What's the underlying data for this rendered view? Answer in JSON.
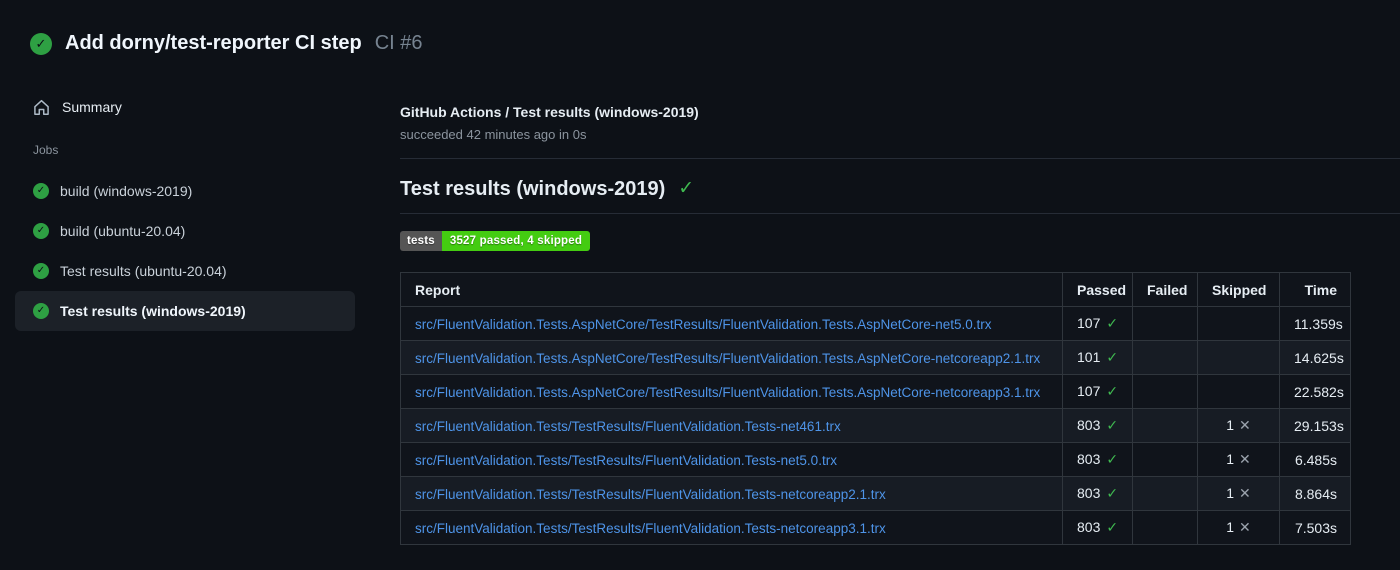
{
  "header": {
    "title": "Add dorny/test-reporter CI step",
    "run_number": "CI #6"
  },
  "sidebar": {
    "summary_label": "Summary",
    "jobs_label": "Jobs",
    "jobs": [
      {
        "label": "build (windows-2019)",
        "selected": false
      },
      {
        "label": "build (ubuntu-20.04)",
        "selected": false
      },
      {
        "label": "Test results (ubuntu-20.04)",
        "selected": false
      },
      {
        "label": "Test results (windows-2019)",
        "selected": true
      }
    ]
  },
  "main": {
    "breadcrumb": "GitHub Actions / Test results (windows-2019)",
    "status_line": "succeeded 42 minutes ago in 0s",
    "section_title": "Test results (windows-2019)",
    "badge": {
      "label": "tests",
      "value": "3527 passed, 4 skipped"
    },
    "table": {
      "columns": [
        "Report",
        "Passed",
        "Failed",
        "Skipped",
        "Time"
      ],
      "rows": [
        {
          "report": "src/FluentValidation.Tests.AspNetCore/TestResults/FluentValidation.Tests.AspNetCore-net5.0.trx",
          "passed": "107",
          "failed": "",
          "skipped": "",
          "time": "11.359s"
        },
        {
          "report": "src/FluentValidation.Tests.AspNetCore/TestResults/FluentValidation.Tests.AspNetCore-netcoreapp2.1.trx",
          "passed": "101",
          "failed": "",
          "skipped": "",
          "time": "14.625s"
        },
        {
          "report": "src/FluentValidation.Tests.AspNetCore/TestResults/FluentValidation.Tests.AspNetCore-netcoreapp3.1.trx",
          "passed": "107",
          "failed": "",
          "skipped": "",
          "time": "22.582s"
        },
        {
          "report": "src/FluentValidation.Tests/TestResults/FluentValidation.Tests-net461.trx",
          "passed": "803",
          "failed": "",
          "skipped": "1",
          "time": "29.153s"
        },
        {
          "report": "src/FluentValidation.Tests/TestResults/FluentValidation.Tests-net5.0.trx",
          "passed": "803",
          "failed": "",
          "skipped": "1",
          "time": "6.485s"
        },
        {
          "report": "src/FluentValidation.Tests/TestResults/FluentValidation.Tests-netcoreapp2.1.trx",
          "passed": "803",
          "failed": "",
          "skipped": "1",
          "time": "8.864s"
        },
        {
          "report": "src/FluentValidation.Tests/TestResults/FluentValidation.Tests-netcoreapp3.1.trx",
          "passed": "803",
          "failed": "",
          "skipped": "1",
          "time": "7.503s"
        }
      ]
    }
  },
  "icons": {
    "check_glyph": "✓",
    "x_glyph": "✕",
    "check_circle": "check-circle-icon",
    "home": "home-icon"
  },
  "colors": {
    "green": "#2ea043",
    "check": "#3fb950",
    "link": "#4e94e8",
    "badge_label_bg": "#555555",
    "badge_value_bg": "#44cc11",
    "muted": "#8b949e"
  }
}
